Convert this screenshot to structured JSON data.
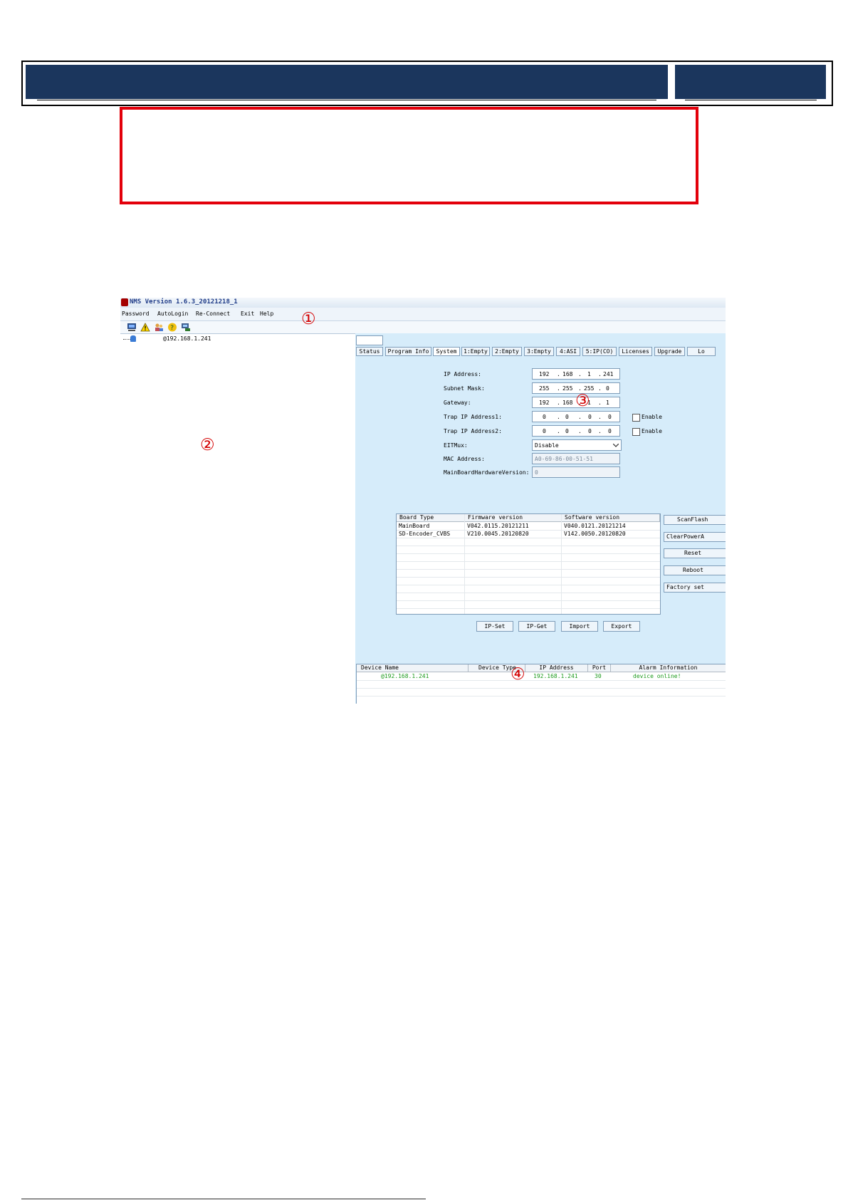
{
  "window": {
    "title": "NMS Version 1.6.3_20121218_1"
  },
  "menu": [
    "Password",
    "AutoLogin",
    "Re-Connect",
    "Exit",
    "Help"
  ],
  "toolbar_icons": [
    "computer-icon",
    "warning-icon",
    "users-icon",
    "help-icon",
    "monitor-icon"
  ],
  "tree": {
    "device_node": "@192.168.1.241"
  },
  "tabs": [
    "Status",
    "Program Info",
    "System",
    "1:Empty",
    "2:Empty",
    "3:Empty",
    "4:ASI",
    "5:IP(CO)",
    "Licenses",
    "Upgrade",
    "Lo"
  ],
  "active_tab": "System",
  "system": {
    "ip_label": "IP Address:",
    "ip": [
      "192",
      "168",
      "1",
      "241"
    ],
    "subnet_label": "Subnet Mask:",
    "subnet": [
      "255",
      "255",
      "255",
      "0"
    ],
    "gateway_label": "Gateway:",
    "gateway": [
      "192",
      "168",
      "1",
      "1"
    ],
    "trap1_label": "Trap IP Address1:",
    "trap1": [
      "0",
      "0",
      "0",
      "0"
    ],
    "trap2_label": "Trap IP Address2:",
    "trap2": [
      "0",
      "0",
      "0",
      "0"
    ],
    "enable_label": "Enable",
    "eitmux_label": "EITMux:",
    "eitmux_value": "Disable",
    "mac_label": "MAC Address:",
    "mac_value": "A0-69-86-00-51-51",
    "hw_label": "MainBoardHardwareVersion:",
    "hw_value": "0"
  },
  "board_table": {
    "headers": [
      "Board Type",
      "Firmware version",
      "Software version"
    ],
    "rows": [
      [
        "MainBoard",
        "V042.0115.20121211",
        "V040.0121.20121214"
      ],
      [
        "SD-Encoder_CVBS",
        "V210.0045.20120820",
        "V142.0050.20120820"
      ]
    ]
  },
  "side_buttons": [
    "ScanFlash",
    "ClearPowerA",
    "Reset",
    "Reboot",
    "Factory set"
  ],
  "bottom_buttons": [
    "IP-Set",
    "IP-Get",
    "Import",
    "Export"
  ],
  "device_table": {
    "headers": [
      "Device Name",
      "Device Type",
      "IP Address",
      "Port",
      "Alarm Information"
    ],
    "rows": [
      [
        "@192.168.1.241",
        "",
        "192.168.1.241",
        "30",
        "device online!"
      ]
    ]
  },
  "markers": [
    "①",
    "②",
    "③",
    "④"
  ],
  "colors": {
    "header_bar": "#1b365d",
    "red_box": "#e3000b",
    "marker": "#d40000",
    "online": "#1b9a1b"
  }
}
